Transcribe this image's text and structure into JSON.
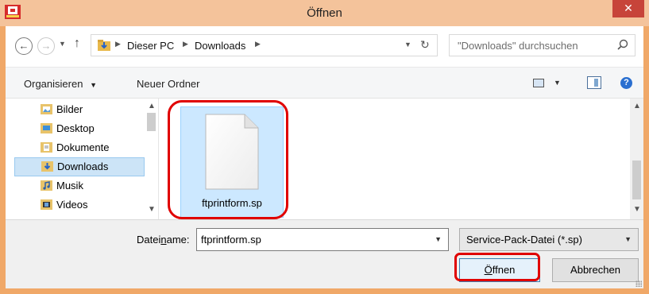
{
  "window": {
    "title": "Öffnen",
    "close_label": "✕"
  },
  "address_bar": {
    "breadcrumb": [
      "Dieser PC",
      "Downloads"
    ],
    "search_placeholder": "\"Downloads\" durchsuchen"
  },
  "toolbar": {
    "organize_label": "Organisieren",
    "new_folder_label": "Neuer Ordner",
    "help_label": "?"
  },
  "nav_pane": {
    "items": [
      {
        "label": "Bilder",
        "icon": "pictures-folder-icon"
      },
      {
        "label": "Desktop",
        "icon": "desktop-folder-icon"
      },
      {
        "label": "Dokumente",
        "icon": "documents-folder-icon"
      },
      {
        "label": "Downloads",
        "icon": "downloads-folder-icon",
        "selected": true
      },
      {
        "label": "Musik",
        "icon": "music-folder-icon"
      },
      {
        "label": "Videos",
        "icon": "videos-folder-icon"
      }
    ]
  },
  "file_pane": {
    "files": [
      {
        "name": "ftprintform.sp",
        "icon": "blank-document-icon",
        "selected": true
      }
    ]
  },
  "bottom": {
    "filename_label_pre": "Datei",
    "filename_label_ul": "n",
    "filename_label_post": "ame:",
    "filename_value": "ftprintform.sp",
    "filetype_value": "Service-Pack-Datei (*.sp)",
    "open_pre": "",
    "open_ul": "Ö",
    "open_post": "ffnen",
    "cancel_label": "Abbrechen"
  },
  "colors": {
    "title_bar": "#f4c39b",
    "close_button": "#c7443a",
    "selection": "#cce8ff",
    "annotation": "#e00000"
  }
}
